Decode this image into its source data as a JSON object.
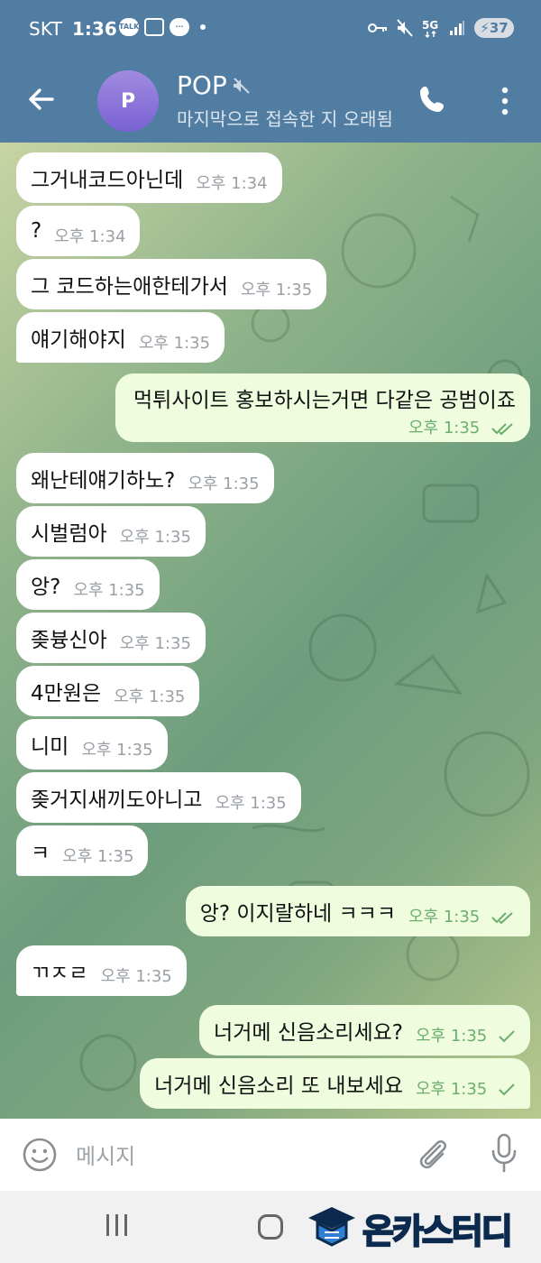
{
  "status_bar": {
    "carrier": "SKT",
    "time": "1:36",
    "notification_icons": [
      "talk-icon",
      "screenshot-icon",
      "chat-icon",
      "dot"
    ],
    "right_icons": [
      "key-icon",
      "mute-icon",
      "5g-icon",
      "signal-icon"
    ],
    "battery": "37"
  },
  "header": {
    "avatar_letter": "P",
    "title": "POP",
    "subtitle": "마지막으로 접속한 지 오래됨",
    "colors": {
      "header_bg": "#527da3",
      "avatar": "#8e78dc"
    }
  },
  "messages": [
    {
      "dir": "in",
      "text": "그거내코드아닌데",
      "time": "오후 1:34"
    },
    {
      "dir": "in",
      "text": "?",
      "time": "오후 1:34"
    },
    {
      "dir": "in",
      "text": "그 코드하는애한테가서",
      "time": "오후 1:35"
    },
    {
      "dir": "in",
      "text": "얘기해야지",
      "time": "오후 1:35"
    },
    {
      "dir": "out",
      "text": "먹튀사이트 홍보하시는거면 다같은 공범이죠",
      "time": "오후 1:35",
      "status": "read"
    },
    {
      "dir": "in",
      "text": "왜난테얘기하노?",
      "time": "오후 1:35"
    },
    {
      "dir": "in",
      "text": "시벌럼아",
      "time": "오후 1:35"
    },
    {
      "dir": "in",
      "text": "앙?",
      "time": "오후 1:35"
    },
    {
      "dir": "in",
      "text": "좆븅신아",
      "time": "오후 1:35"
    },
    {
      "dir": "in",
      "text": "4만원은",
      "time": "오후 1:35"
    },
    {
      "dir": "in",
      "text": "니미",
      "time": "오후 1:35"
    },
    {
      "dir": "in",
      "text": "좆거지새끼도아니고",
      "time": "오후 1:35"
    },
    {
      "dir": "in",
      "text": "ㅋ",
      "time": "오후 1:35"
    },
    {
      "dir": "out",
      "text": "앙? 이지랄하네 ㅋㅋㅋ",
      "time": "오후 1:35",
      "status": "read"
    },
    {
      "dir": "in",
      "text": "ㄲㅈㄹ",
      "time": "오후 1:35"
    },
    {
      "dir": "out",
      "text": "너거메 신음소리세요?",
      "time": "오후 1:35",
      "status": "sent"
    },
    {
      "dir": "out",
      "text": "너거메 신음소리 또 내보세요",
      "time": "오후 1:35",
      "status": "sent"
    }
  ],
  "input": {
    "placeholder": "메시지"
  },
  "watermark": {
    "text": "온카스터디"
  },
  "colors": {
    "incoming_bubble": "#ffffff",
    "outgoing_bubble": "#effdde",
    "time_out": "#6bae6d",
    "time_in": "#9aa0a6"
  }
}
